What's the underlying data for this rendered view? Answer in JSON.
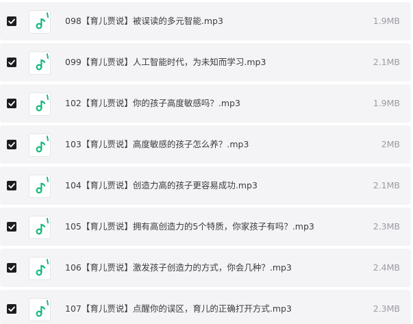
{
  "colors": {
    "row_background": "#f4f4f6",
    "checkbox_fill": "#1d1d1f",
    "audio_icon_accent": "#12b87a",
    "name_text": "#3b3b3f",
    "size_text": "#9a9aa2"
  },
  "icons": {
    "checkbox": "checked-checkbox-icon",
    "file_type": "audio-file-music-note-icon"
  },
  "files": [
    {
      "checked": true,
      "name": "098【育儿贾说】被误读的多元智能.mp3",
      "size": "1.9MB"
    },
    {
      "checked": true,
      "name": "099【育儿贾说】人工智能时代，为未知而学习.mp3",
      "size": "2.1MB"
    },
    {
      "checked": true,
      "name": "102【育儿贾说】你的孩子高度敏感吗？.mp3",
      "size": "1.9MB"
    },
    {
      "checked": true,
      "name": "103【育儿贾说】高度敏感的孩子怎么养？.mp3",
      "size": "2MB"
    },
    {
      "checked": true,
      "name": "104【育儿贾说】创造力高的孩子更容易成功.mp3",
      "size": "2.1MB"
    },
    {
      "checked": true,
      "name": "105【育儿贾说】拥有高创造力的5个特质，你家孩子有吗？.mp3",
      "size": "2.3MB"
    },
    {
      "checked": true,
      "name": "106【育儿贾说】激发孩子创造力的方式，你会几种？.mp3",
      "size": "2.4MB"
    },
    {
      "checked": true,
      "name": "107【育儿贾说】点醒你的误区，育儿的正确打开方式.mp3",
      "size": "2.3MB"
    }
  ]
}
